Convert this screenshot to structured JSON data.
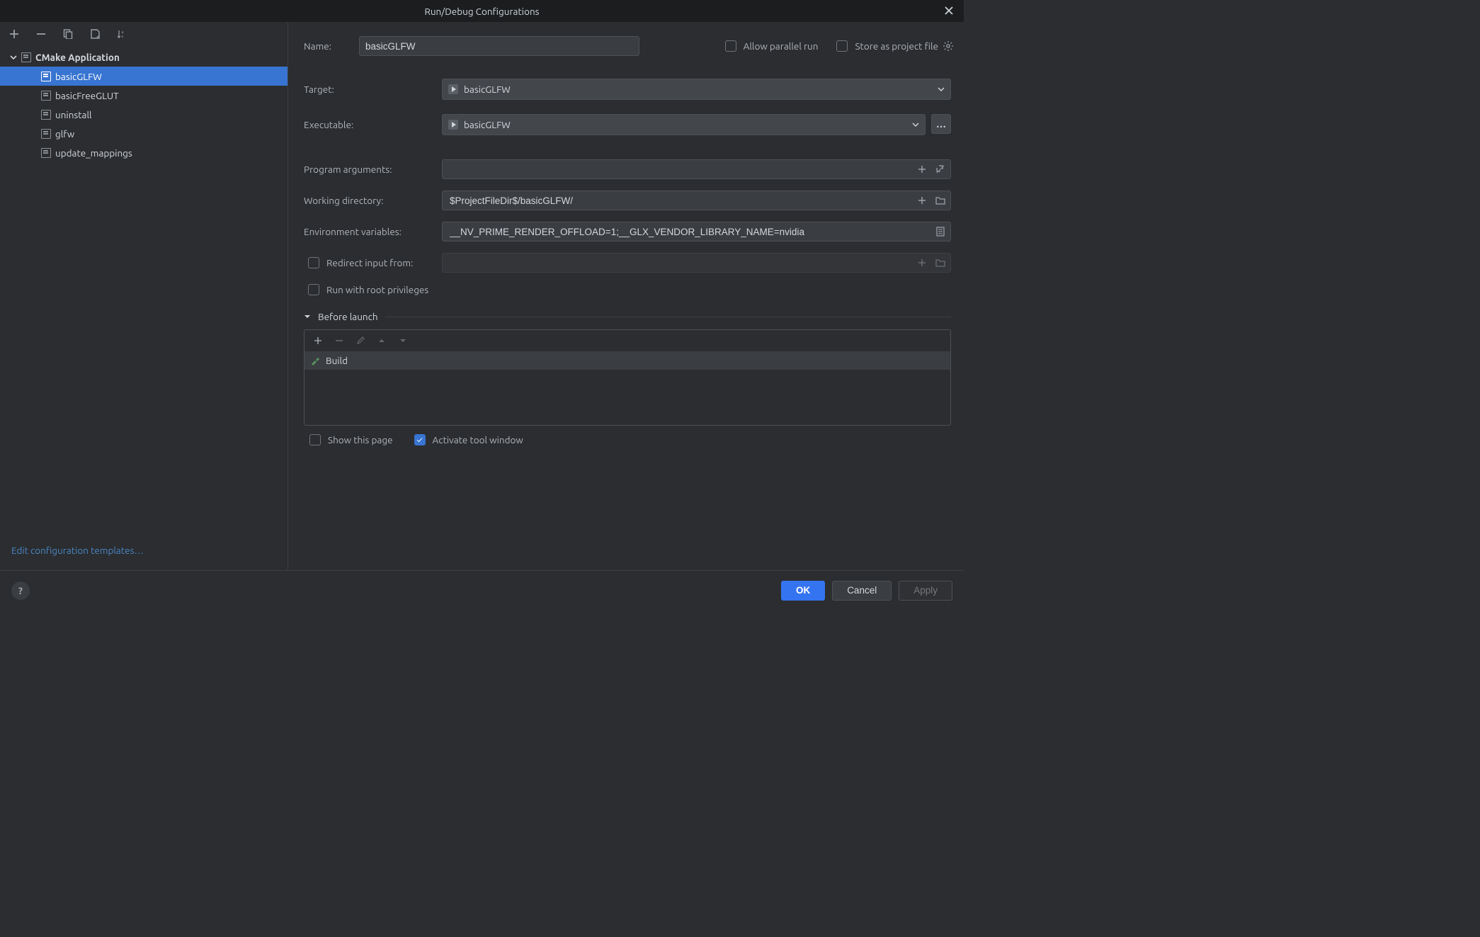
{
  "title": "Run/Debug Configurations",
  "sidebar": {
    "category": "CMake Application",
    "items": [
      {
        "label": "basicGLFW"
      },
      {
        "label": "basicFreeGLUT"
      },
      {
        "label": "uninstall"
      },
      {
        "label": "glfw"
      },
      {
        "label": "update_mappings"
      }
    ],
    "footer_link": "Edit configuration templates…"
  },
  "form": {
    "name_lbl": "Name:",
    "name_val": "basicGLFW",
    "parallel_lbl": "Allow parallel run",
    "store_lbl": "Store as project file",
    "target_lbl": "Target:",
    "target_val": "basicGLFW",
    "exe_lbl": "Executable:",
    "exe_val": "basicGLFW",
    "args_lbl": "Program arguments:",
    "args_val": "",
    "wd_lbl": "Working directory:",
    "wd_val": "$ProjectFileDir$/basicGLFW/",
    "env_lbl": "Environment variables:",
    "env_val": "__NV_PRIME_RENDER_OFFLOAD=1;__GLX_VENDOR_LIBRARY_NAME=nvidia",
    "redirect_lbl": "Redirect input from:",
    "root_lbl": "Run with root privileges",
    "before_launch_lbl": "Before launch",
    "build_lbl": "Build",
    "show_page_lbl": "Show this page",
    "activate_tw_lbl": "Activate tool window"
  },
  "buttons": {
    "ok": "OK",
    "cancel": "Cancel",
    "apply": "Apply"
  }
}
